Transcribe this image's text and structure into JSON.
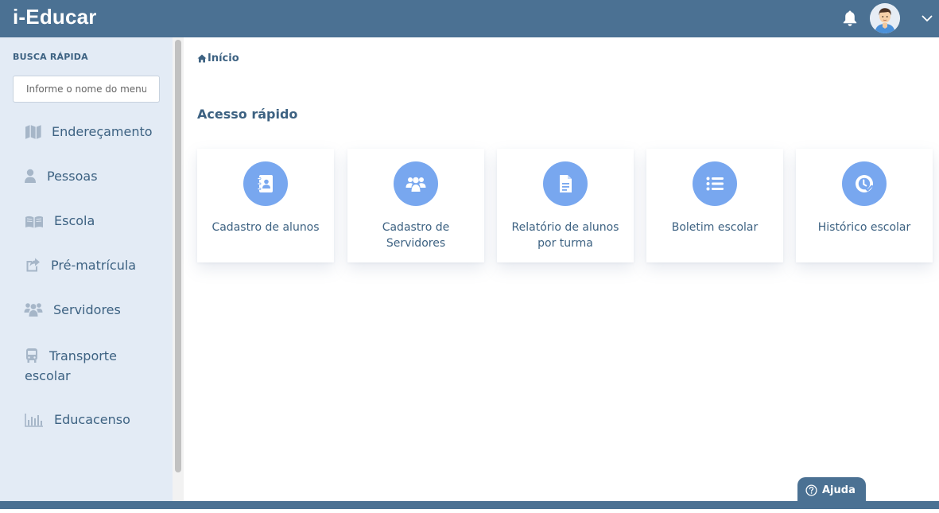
{
  "header": {
    "brand": "i-Educar",
    "icons": [
      "bell-icon",
      "user-avatar",
      "chevron-down-icon"
    ]
  },
  "sidebar": {
    "search_label": "BUSCA RÁPIDA",
    "search_placeholder": "Informe o nome do menu",
    "items": [
      {
        "label": "Endereçamento",
        "icon": "map-icon"
      },
      {
        "label": "Pessoas",
        "icon": "user-icon"
      },
      {
        "label": "Escola",
        "icon": "book-open-icon"
      },
      {
        "label": "Pré-matrícula",
        "icon": "share-icon"
      },
      {
        "label": "Servidores",
        "icon": "users-icon"
      },
      {
        "label": "Transporte",
        "label2": "escolar",
        "icon": "bus-icon"
      },
      {
        "label": "Educacenso",
        "icon": "bar-chart-icon"
      }
    ]
  },
  "main": {
    "breadcrumb": "Início",
    "section_title": "Acesso rápido",
    "cards": [
      {
        "line1": "Cadastro de alunos",
        "line2": "",
        "icon": "address-book-icon"
      },
      {
        "line1": "Cadastro de",
        "line2": "Servidores",
        "icon": "users-icon"
      },
      {
        "line1": "Relatório de alunos",
        "line2": "por turma",
        "icon": "file-text-icon"
      },
      {
        "line1": "Boletim escolar",
        "line2": "",
        "icon": "list-icon"
      },
      {
        "line1": "Histórico escolar",
        "line2": "",
        "icon": "history-check-icon"
      }
    ]
  },
  "help": {
    "label": "Ajuda",
    "icon": "question-circle-icon"
  },
  "colors": {
    "topbar": "#4b7193",
    "sidebar": "#e3ebf5",
    "accent_circle": "#78a7ef",
    "text": "#3d6282"
  }
}
